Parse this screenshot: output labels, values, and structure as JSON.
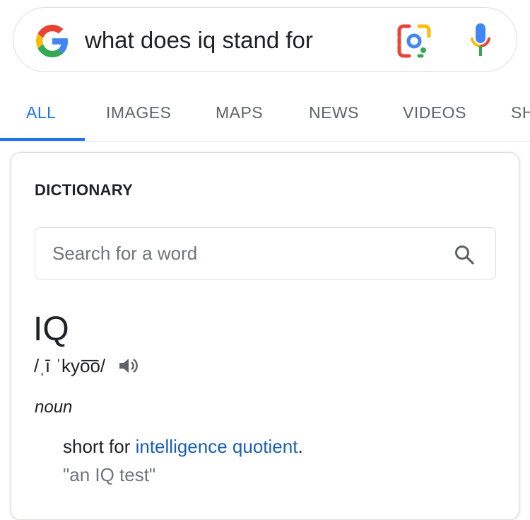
{
  "search": {
    "query": "what does iq stand for"
  },
  "tabs": [
    {
      "label": "ALL",
      "active": true
    },
    {
      "label": "IMAGES",
      "active": false
    },
    {
      "label": "MAPS",
      "active": false
    },
    {
      "label": "NEWS",
      "active": false
    },
    {
      "label": "VIDEOS",
      "active": false
    },
    {
      "label": "SH",
      "active": false
    }
  ],
  "dictionary": {
    "title": "DICTIONARY",
    "search_placeholder": "Search for a word",
    "headword": "IQ",
    "phonetic": "/ˌī ˈkyo͞o/",
    "part_of_speech": "noun",
    "definition_prefix": "short for ",
    "definition_link": "intelligence quotient",
    "definition_suffix": ".",
    "example": "\"an IQ test\""
  },
  "colors": {
    "accent": "#1a73e8",
    "google_blue": "#4285F4",
    "google_red": "#EA4335",
    "google_yellow": "#FBBC05",
    "google_green": "#34A853"
  },
  "icons": [
    "google-logo-icon",
    "google-lens-icon",
    "microphone-icon",
    "search-icon",
    "speaker-icon"
  ]
}
